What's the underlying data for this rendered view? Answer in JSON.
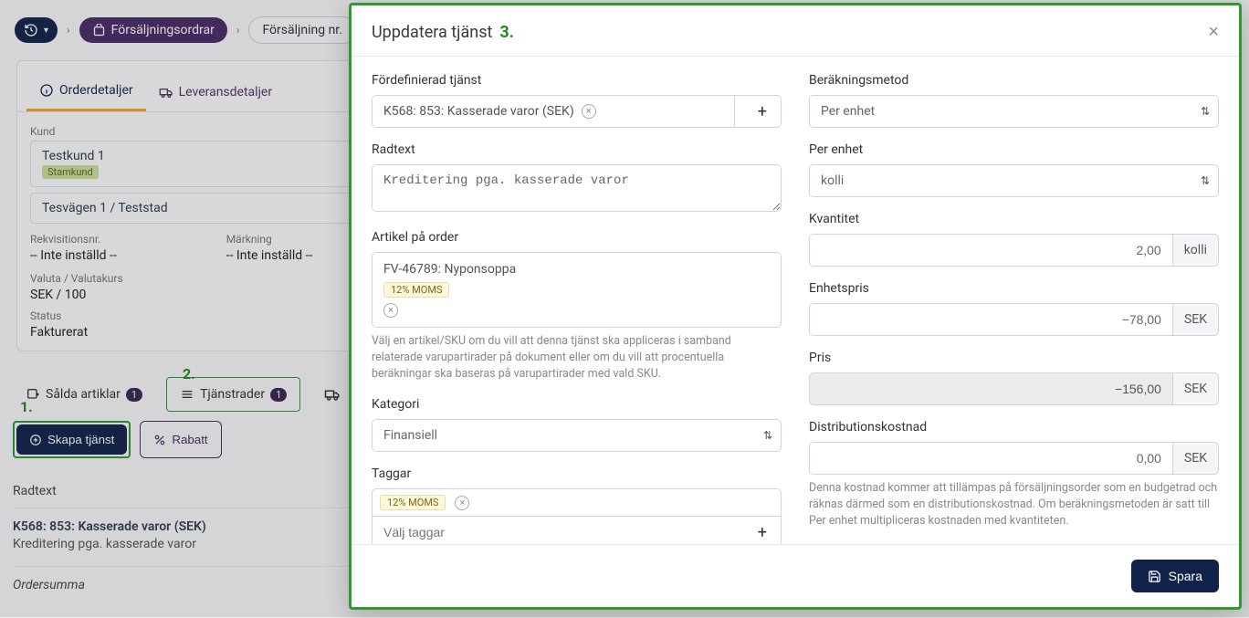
{
  "breadcrumb": {
    "orders_label": "Försäljningsordrar",
    "current_label": "Försäljning nr."
  },
  "order_tabs": {
    "details": "Orderdetaljer",
    "delivery": "Leveransdetaljer"
  },
  "customer": {
    "label": "Kund",
    "name": "Testkund 1",
    "badge": "Stamkund",
    "address": "Tesvägen 1 / Teststad"
  },
  "details": {
    "req_label": "Rekvisitionsnr.",
    "req_val": "-- Inte inställd --",
    "mark_label": "Märkning",
    "mark_val": "-- Inte inställd --",
    "currency_label": "Valuta / Valutakurs",
    "currency_val": "SEK / 100",
    "status_label": "Status",
    "status_val": "Fakturerat"
  },
  "tabs2": {
    "sold_label": "Sålda artiklar",
    "sold_count": "1",
    "svc_label": "Tjänstrader",
    "svc_count": "1"
  },
  "buttons": {
    "create_service": "Skapa tjänst",
    "discount": "Rabatt"
  },
  "table": {
    "head": "Radtext",
    "row_title": "K568: 853: Kasserade varor (SEK)",
    "row_sub": "Kreditering pga. kasserade varor",
    "footer": "Ordersumma"
  },
  "annotations": {
    "one": "1.",
    "two": "2.",
    "three": "3."
  },
  "modal": {
    "title": "Uppdatera tjänst",
    "left": {
      "predef_label": "Fördefinierad tjänst",
      "predef_value": "K568: 853: Kasserade varor (SEK)",
      "rowtext_label": "Radtext",
      "rowtext_value": "Kreditering pga. kasserade varor",
      "article_label": "Artikel på order",
      "article_value": "FV-46789: Nyponsoppa",
      "article_chip": "12% MOMS",
      "article_help": "Välj en artikel/SKU om du vill att denna tjänst ska appliceras i samband relaterade varupartirader på dokument eller om du vill att procentuella beräkningar ska baseras på varupartirader med vald SKU.",
      "category_label": "Kategori",
      "category_value": "Finansiell",
      "tags_label": "Taggar",
      "tags_chip": "12% MOMS",
      "tags_placeholder": "Välj taggar"
    },
    "right": {
      "calc_label": "Beräkningsmetod",
      "calc_value": "Per enhet",
      "per_unit_label": "Per enhet",
      "per_unit_value": "kolli",
      "qty_label": "Kvantitet",
      "qty_value": "2,00",
      "qty_unit": "kolli",
      "unitprice_label": "Enhetspris",
      "unitprice_value": "−78,00",
      "unitprice_unit": "SEK",
      "price_label": "Pris",
      "price_value": "−156,00",
      "price_unit": "SEK",
      "dist_label": "Distributionskostnad",
      "dist_value": "0,00",
      "dist_unit": "SEK",
      "dist_help": "Denna kostnad kommer att tillämpas på försäljningsorder som en budgetrad och räknas därmed som en distributionskostnad. Om beräkningsmetoden är satt till Per enhet multipliceras kostnaden med kvantiteten."
    },
    "save": "Spara"
  }
}
